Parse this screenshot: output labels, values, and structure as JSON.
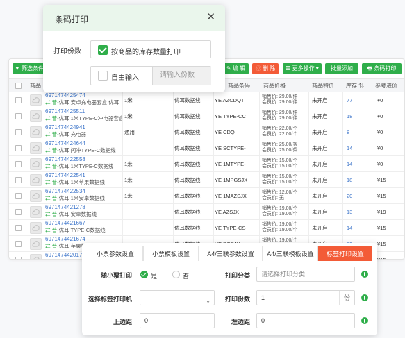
{
  "toolbar": {
    "filter_label": "▼ 筛选条件",
    "edit_label": "✎ 编 辑",
    "delete_label": "♲ 删 除",
    "more_label": "☰ 更多操作",
    "batch_add_label": "批量添加",
    "barcode_label": "条码打印"
  },
  "table": {
    "headers": [
      "商品",
      "商品条码",
      "商品价格",
      "商品特价",
      "库存",
      "参考进价"
    ],
    "rows": [
      {
        "code": "6971474425474",
        "name": "优耳 安卓充电器套盒 优耳",
        "spec": "1米",
        "brand": "优耳数据线",
        "barcode": "YE AZCDQT",
        "price1": "销售价: 29.00/件",
        "price2": "会员价: 29.00/件",
        "special": "未开启",
        "stock": "77",
        "cost": "¥0"
      },
      {
        "code": "6971474425511",
        "name": "优耳 1米TYPE-C冲电器套盒",
        "spec": "1米",
        "brand": "优耳数据线",
        "barcode": "YE TYPE-CC",
        "price1": "销售价: 29.00/件",
        "price2": "会员价: 29.00/件",
        "special": "未开启",
        "stock": "18",
        "cost": "¥0"
      },
      {
        "code": "6971474424941",
        "name": "优耳 充电器",
        "spec": "通用",
        "brand": "优耳数据线",
        "barcode": "YE CDQ",
        "price1": "销售价: 22.00/个",
        "price2": "会员价: 22.00/个",
        "special": "未开启",
        "stock": "8",
        "cost": "¥0"
      },
      {
        "code": "6971474424644",
        "name": "优耳 闪冲TYPE-C数据线",
        "spec": "",
        "brand": "优耳数据线",
        "barcode": "YE SCTYPE-",
        "price1": "销售价: 25.00/条",
        "price2": "会员价: 25.00/条",
        "special": "未开启",
        "stock": "14",
        "cost": "¥0"
      },
      {
        "code": "6971474422558",
        "name": "优耳 1米TYPE-C数据线",
        "spec": "1米",
        "brand": "优耳数据线",
        "barcode": "YE 1MTYPE-",
        "price1": "销售价: 15.00/个",
        "price2": "会员价: 15.00/个",
        "special": "未开启",
        "stock": "14",
        "cost": "¥0"
      },
      {
        "code": "6971474422541",
        "name": "优耳 1米苹果数据线",
        "spec": "1米",
        "brand": "优耳数据线",
        "barcode": "YE 1MPGSJX",
        "price1": "销售价: 15.00/个",
        "price2": "会员价: 15.00/个",
        "special": "未开启",
        "stock": "18",
        "cost": "¥15"
      },
      {
        "code": "6971474422534",
        "name": "优耳 1米安卓数据线",
        "spec": "1米",
        "brand": "优耳数据线",
        "barcode": "YE 1MAZSJX",
        "price1": "销售价: 12.00/个",
        "price2": "会员价: 无",
        "special": "未开启",
        "stock": "20",
        "cost": "¥15"
      },
      {
        "code": "6971474421278",
        "name": "优耳 安卓数据线",
        "spec": "",
        "brand": "优耳数据线",
        "barcode": "YE AZSJX",
        "price1": "销售价: 19.00/个",
        "price2": "会员价: 19.00/个",
        "special": "未开启",
        "stock": "13",
        "cost": "¥19"
      },
      {
        "code": "6971474421667",
        "name": "优耳 TYPE-C数据线",
        "spec": "",
        "brand": "优耳数据线",
        "barcode": "YE TYPE-CS",
        "price1": "销售价: 19.00/个",
        "price2": "会员价: 19.00/个",
        "special": "未开启",
        "stock": "14",
        "cost": "¥15"
      },
      {
        "code": "6971474421674",
        "name": "优耳 苹果数据线",
        "spec": "",
        "brand": "优耳数据线",
        "barcode": "YE PGSJX",
        "price1": "销售价: 19.00/个",
        "price2": "会员价: 19.00/个",
        "special": "未开启",
        "stock": "19",
        "cost": "¥15"
      },
      {
        "code": "6971474420172",
        "name": "优耳 数据线",
        "spec": "",
        "brand": "优耳数据线",
        "barcode": "YE SJX",
        "price1": "销售价: 19.00/个",
        "price2": "会员价: 19.00/个",
        "special": "未开启",
        "stock": "16",
        "cost": "¥15"
      }
    ]
  },
  "dialog": {
    "title": "条码打印",
    "copies_label": "打印份数",
    "by_stock_label": "按商品的库存数量打印",
    "manual_label": "自由输入",
    "copies_placeholder": "请输入份数"
  },
  "settings": {
    "tabs": [
      "小票参数设置",
      "小票模板设置",
      "A4/三联参数设置",
      "A4/三联模板设置",
      "标签打印设置"
    ],
    "ticket_print_label": "随小票打印",
    "yes_label": "是",
    "no_label": "否",
    "print_category_label": "打印分类",
    "print_category_placeholder": "请选择打印分类",
    "label_printer_label": "选择标签打印机",
    "print_copies_label": "打印份数",
    "print_copies_value": "1",
    "copies_unit": "份",
    "top_margin_label": "上边距",
    "top_margin_value": "0",
    "left_margin_label": "左边距",
    "left_margin_value": "0"
  }
}
